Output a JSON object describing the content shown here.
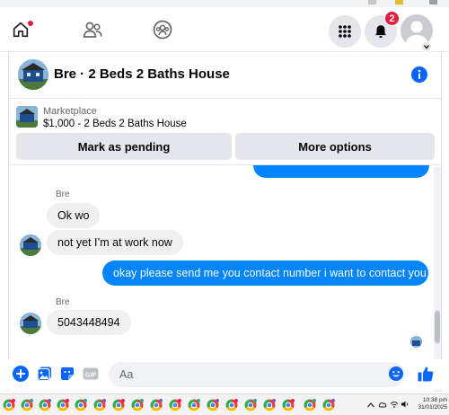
{
  "nav": {
    "notifications_badge": "2"
  },
  "chat": {
    "title": "Bre · 2 Beds 2 Baths House",
    "marketplace_label": "Marketplace",
    "listing": "$1,000 - 2 Beds 2 Baths House",
    "mark_pending_label": "Mark as pending",
    "more_options_label": "More options",
    "messages": [
      {
        "sender": "Bre",
        "text": "Ok wo",
        "direction": "incoming"
      },
      {
        "text": "not yet I’m at work now",
        "direction": "incoming"
      },
      {
        "text": "okay please send me you contact number i want to contact you",
        "direction": "outgoing"
      },
      {
        "sender": "Bre",
        "text": "5043448494",
        "direction": "incoming"
      }
    ]
  },
  "composer": {
    "placeholder": "Aa",
    "icons": [
      "add-icon",
      "photo-icon",
      "sticker-icon",
      "gif-icon",
      "emoji-icon",
      "like-icon"
    ],
    "gif_label": "GIF"
  },
  "taskbar": {
    "time": "10:38 pm",
    "date": "31/01/2025"
  },
  "colors": {
    "accent": "#0866ff",
    "outgoing_bubble": "#0084ff",
    "incoming_bubble": "#f0f0f0",
    "badge": "#e41e3f"
  }
}
